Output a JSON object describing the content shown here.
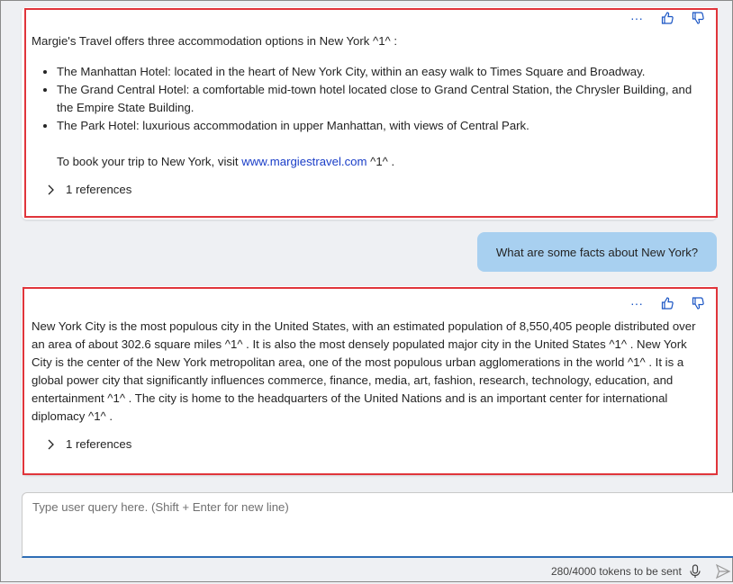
{
  "messages": [
    {
      "intro": "Margie's Travel offers three accommodation options in New York ^1^ :",
      "items": [
        "The Manhattan Hotel: located in the heart of New York City, within an easy walk to Times Square and Broadway.",
        "The Grand Central Hotel: a comfortable mid-town hotel located close to Grand Central Station, the Chrysler Building, and the Empire State Building.",
        "The Park Hotel: luxurious accommodation in upper Manhattan, with views of Central Park."
      ],
      "book_prefix": "To book your trip to New York, visit",
      "book_link": "www.margiestravel.com",
      "book_suffix": "^1^ .",
      "references": "1 references"
    },
    {
      "user_query": "What are some facts about New York?"
    },
    {
      "text": "New York City is the most populous city in the United States, with an estimated population of 8,550,405 people distributed over an area of about 302.6 square miles ^1^ . It is also the most densely populated major city in the United States ^1^ . New York City is the center of the New York metropolitan area, one of the most populous urban agglomerations in the world ^1^ . It is a global power city that significantly influences commerce, finance, media, art, fashion, research, technology, education, and entertainment ^1^ . The city is home to the headquarters of the United Nations and is an important center for international diplomacy ^1^ .",
      "references": "1 references"
    }
  ],
  "actions": {
    "more": "···"
  },
  "composer": {
    "placeholder": "Type user query here. (Shift + Enter for new line)"
  },
  "footer": {
    "tokens": "280/4000 tokens to be sent"
  },
  "colors": {
    "highlight": "#e0353b",
    "user_bubble": "#a8d0f0",
    "accent": "#1a55c4"
  }
}
